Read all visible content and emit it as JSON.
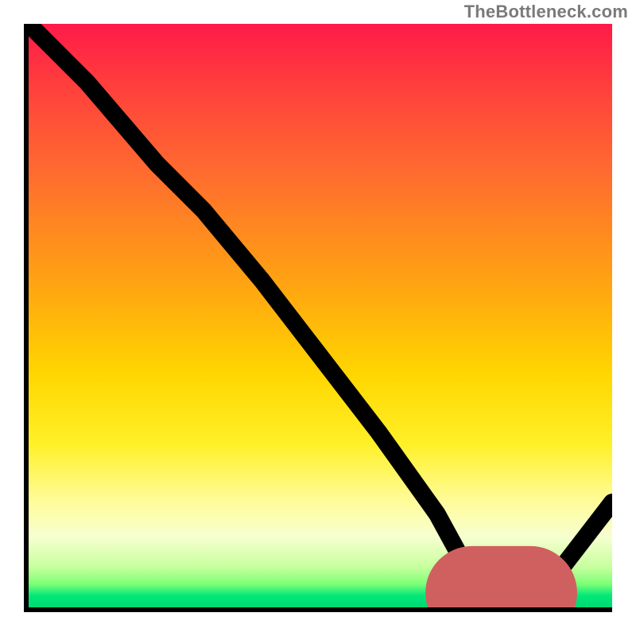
{
  "source": {
    "label": "TheBottleneck.com"
  },
  "chart_data": {
    "type": "line",
    "title": "",
    "xlabel": "",
    "ylabel": "",
    "xlim": [
      0,
      100
    ],
    "ylim": [
      0,
      100
    ],
    "grid": false,
    "legend": false,
    "background": {
      "type": "vertical-gradient-red-to-green",
      "note": "red (top) → orange → yellow → green (bottom)"
    },
    "series": [
      {
        "name": "bottleneck-curve",
        "color": "#000000",
        "x": [
          0,
          10,
          22,
          30,
          40,
          50,
          60,
          70,
          76,
          80,
          85,
          90,
          100
        ],
        "y": [
          100,
          90,
          76,
          68,
          56,
          43,
          30,
          16,
          5,
          1,
          1,
          5,
          18
        ]
      }
    ],
    "marker": {
      "name": "optimal-range",
      "color": "#d06060",
      "x_start": 76,
      "x_end": 86,
      "y": 2.5
    }
  }
}
